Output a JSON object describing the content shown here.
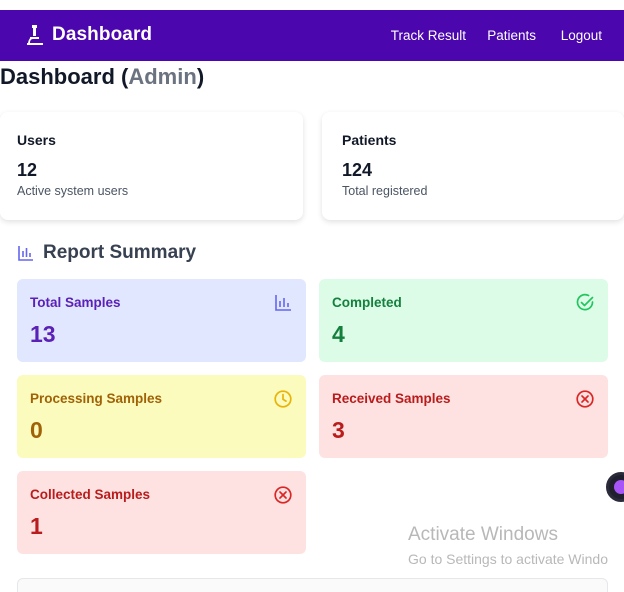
{
  "navbar": {
    "brand": "Dashboard",
    "links": [
      {
        "label": "Track Result"
      },
      {
        "label": "Patients"
      },
      {
        "label": "Logout"
      }
    ],
    "background": "#4b06ad"
  },
  "page": {
    "title_prefix": "Dashboard (",
    "title_role": "Admin",
    "title_suffix": ")"
  },
  "stats": [
    {
      "label": "Users",
      "value": "12",
      "sub": "Active system users"
    },
    {
      "label": "Patients",
      "value": "124",
      "sub": "Total registered"
    }
  ],
  "report": {
    "title": "Report Summary",
    "tiles": [
      {
        "label": "Total Samples",
        "value": "13",
        "icon": "bar-chart-icon",
        "bg": "#e0e7ff",
        "color": "#5b21b6"
      },
      {
        "label": "Completed",
        "value": "4",
        "icon": "check-circle-icon",
        "bg": "#dcfce7",
        "color": "#15803d"
      },
      {
        "label": "Processing Samples",
        "value": "0",
        "icon": "clock-icon",
        "bg": "#fafbbd",
        "color": "#a16207"
      },
      {
        "label": "Received Samples",
        "value": "3",
        "icon": "x-circle-icon",
        "bg": "#fee2e2",
        "color": "#b91c1c"
      },
      {
        "label": "Collected Samples",
        "value": "1",
        "icon": "x-circle-icon",
        "bg": "#fee2e2",
        "color": "#b91c1c"
      }
    ]
  },
  "watermark": {
    "line1": "Activate Windows",
    "line2": "Go to Settings to activate Windo"
  }
}
